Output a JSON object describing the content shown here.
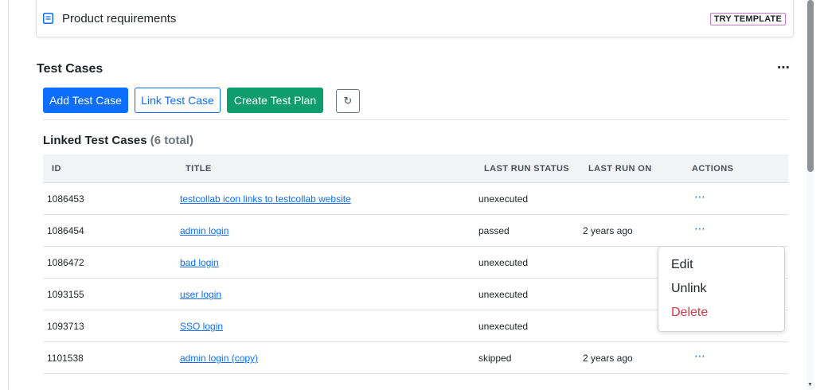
{
  "template_card": {
    "title": "Product requirements",
    "try_label": "TRY TEMPLATE",
    "icon": "document-icon"
  },
  "section": {
    "title": "Test Cases",
    "more_label": "⋯"
  },
  "toolbar": {
    "add_label": "Add Test Case",
    "link_label": "Link Test Case",
    "plan_label": "Create Test Plan",
    "refresh_label": "↻"
  },
  "linked": {
    "heading": "Linked Test Cases",
    "count": "(6 total)"
  },
  "table": {
    "headers": {
      "id": "ID",
      "title": "TITLE",
      "status": "LAST RUN STATUS",
      "last_run": "LAST RUN ON",
      "actions": "ACTIONS"
    },
    "rows": [
      {
        "id": "1086453",
        "title": "testcollab icon links to testcollab website",
        "status": "unexecuted",
        "last_run": "",
        "actions": "⋯"
      },
      {
        "id": "1086454",
        "title": "admin login",
        "status": "passed",
        "last_run": "2 years ago",
        "actions": "⋯"
      },
      {
        "id": "1086472",
        "title": "bad login",
        "status": "unexecuted",
        "last_run": "",
        "actions": ""
      },
      {
        "id": "1093155",
        "title": "user login",
        "status": "unexecuted",
        "last_run": "",
        "actions": ""
      },
      {
        "id": "1093713",
        "title": "SSO login",
        "status": "unexecuted",
        "last_run": "",
        "actions": ""
      },
      {
        "id": "1101538",
        "title": "admin login (copy)",
        "status": "skipped",
        "last_run": "2 years ago",
        "actions": "⋯"
      }
    ]
  },
  "dropdown": {
    "edit": "Edit",
    "unlink": "Unlink",
    "delete": "Delete"
  },
  "colors": {
    "primary": "#0d6efd",
    "success": "#0f9d6e",
    "danger": "#dc3545"
  }
}
